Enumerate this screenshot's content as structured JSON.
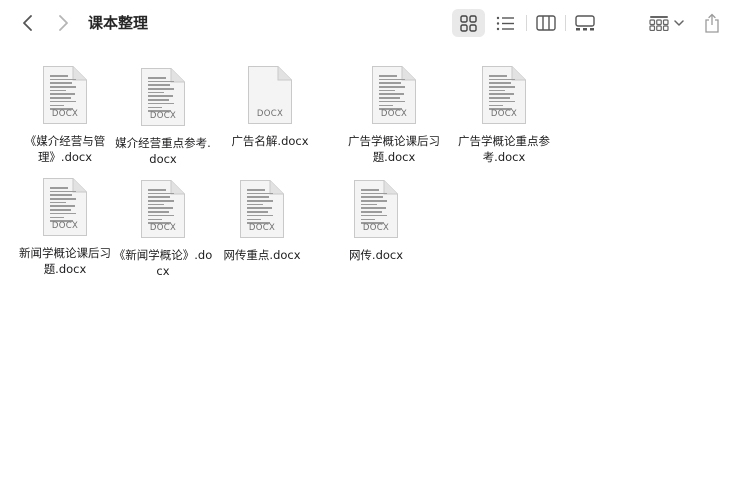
{
  "window": {
    "title": "课本整理"
  },
  "icons": {
    "back": "chevron-left-icon",
    "forward": "chevron-right-icon",
    "grid": "grid-view-icon",
    "list": "list-view-icon",
    "columns": "column-view-icon",
    "gallery": "gallery-view-icon",
    "group": "group-by-icon",
    "share": "share-icon"
  },
  "files": [
    {
      "name": "《媒介经营与管理》.docx",
      "ext": "DOCX",
      "preview": true
    },
    {
      "name": "媒介经营重点参考.docx",
      "ext": "DOCX",
      "preview": true
    },
    {
      "name": "广告名解.docx",
      "ext": "DOCX",
      "preview": false
    },
    {
      "name": "广告学概论课后习题.docx",
      "ext": "DOCX",
      "preview": true
    },
    {
      "name": "广告学概论重点参考.docx",
      "ext": "DOCX",
      "preview": true
    },
    {
      "name": "新闻学概论课后习题.docx",
      "ext": "DOCX",
      "preview": true
    },
    {
      "name": "《新闻学概论》.docx",
      "ext": "DOCX",
      "preview": true
    },
    {
      "name": "网传重点.docx",
      "ext": "DOCX",
      "preview": true
    },
    {
      "name": "网传.docx",
      "ext": "DOCX",
      "preview": true
    }
  ]
}
